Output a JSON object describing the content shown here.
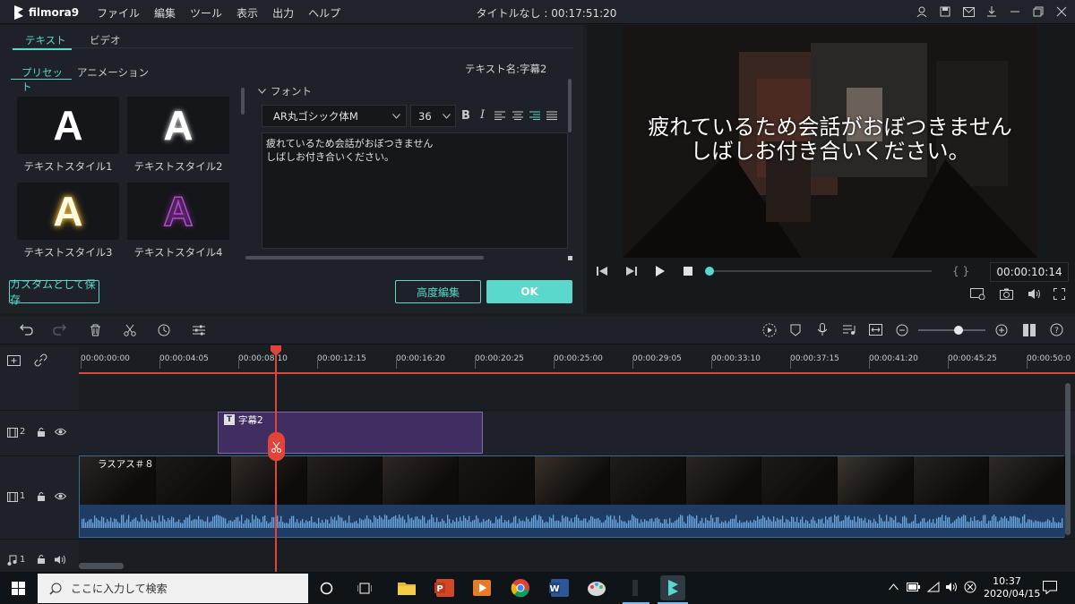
{
  "app": {
    "logo_text": "filmora9",
    "menu": [
      "ファイル",
      "編集",
      "ツール",
      "表示",
      "出力",
      "ヘルプ"
    ],
    "window_title": "タイトルなし : 00:17:51:20",
    "accent": "#5ad8cc"
  },
  "editor": {
    "tabs": [
      "テキスト",
      "ビデオ"
    ],
    "subtabs": [
      "プリセット",
      "アニメーション"
    ],
    "text_name": "テキスト名:字幕2",
    "styles": [
      {
        "label": "テキストスタイル1",
        "glyph": "A"
      },
      {
        "label": "テキストスタイル2",
        "glyph": "A"
      },
      {
        "label": "テキストスタイル3",
        "glyph": "A"
      },
      {
        "label": "テキストスタイル4",
        "glyph": "A"
      }
    ],
    "font_section": "フォント",
    "font_name": "AR丸ゴシック体M",
    "font_size": "36",
    "bold": "B",
    "italic": "I",
    "text_line1": "疲れているため会話がおぼつきません",
    "text_line2": "しばしお付き合いください。",
    "save_custom": "カスタムとして保存",
    "advanced": "高度編集",
    "ok": "OK"
  },
  "preview": {
    "caption_line1": "疲れているため会話がおぼつきません",
    "caption_line2": "しばしお付き合いください。",
    "timecode": "00:00:10:14",
    "braces": "{  }",
    "progress_percent": 0
  },
  "timeline": {
    "ruler": [
      "00:00:00:00",
      "00:00:04:05",
      "00:00:08:10",
      "00:00:12:15",
      "00:00:16:20",
      "00:00:20:25",
      "00:00:25:00",
      "00:00:29:05",
      "00:00:33:10",
      "00:00:37:15",
      "00:00:41:20",
      "00:00:45:25",
      "00:00:50:0"
    ],
    "tracks": [
      {
        "num": "2",
        "type": "video"
      },
      {
        "num": "1",
        "type": "video"
      },
      {
        "num": "1",
        "type": "audio"
      }
    ],
    "title_clip": "字幕2",
    "title_clip_icon": "T",
    "video_clip": "ラスアス＃８"
  },
  "taskbar": {
    "search_placeholder": "ここに入力して検索",
    "time": "10:37",
    "date": "2020/04/15"
  }
}
